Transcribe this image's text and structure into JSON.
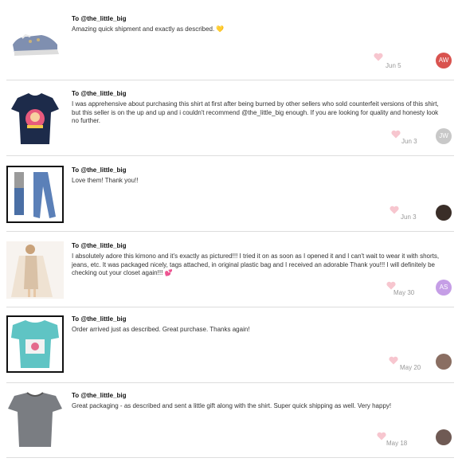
{
  "reviews": [
    {
      "to": "To @the_little_big",
      "message": "Amazing quick shipment and exactly as described. 💛",
      "date": "Jun 5",
      "avatar": {
        "initials": "AW",
        "color": "#d9534f"
      },
      "thumb": "sneaker-thumbnail"
    },
    {
      "to": "To @the_little_big",
      "message": "I was apprehensive about purchasing this shirt at first after being burned by other sellers who sold counterfeit versions of this shirt, but this seller is on the up and up and i couldn't recommend @the_little_big enough. If you are looking for quality and honesty look no further.",
      "date": "Jun 3",
      "avatar": {
        "initials": "JW",
        "color": "#c8c8c8"
      },
      "thumb": "tshirt-thumbnail"
    },
    {
      "to": "To @the_little_big",
      "message": "Love them! Thank you!!",
      "date": "Jun 3",
      "avatar": {
        "initials": "",
        "color": "#3a2e28"
      },
      "thumb": "jeans-thumbnail"
    },
    {
      "to": "To @the_little_big",
      "message": "I absolutely adore this kimono and it's exactly as pictured!!! I tried it on as soon as I opened it and I can't wait to wear it with shorts, jeans, etc. It was packaged nicely, tags attached, in original plastic bag and I received an adorable Thank you!!! I will definitely be checking out your closet again!!! 💕",
      "date": "May 30",
      "avatar": {
        "initials": "AS",
        "color": "#c59ee6"
      },
      "thumb": "kimono-thumbnail"
    },
    {
      "to": "To @the_little_big",
      "message": "Order arrived just as described. Great purchase. Thanks again!",
      "date": "May 20",
      "avatar": {
        "initials": "",
        "color": "#8a6e62"
      },
      "thumb": "teal-shirt-thumbnail"
    },
    {
      "to": "To @the_little_big",
      "message": "Great packaging - as described and sent a little gift along with the shirt. Super quick shipping as well. Very happy!",
      "date": "May 18",
      "avatar": {
        "initials": "",
        "color": "#6f5a54"
      },
      "thumb": "gray-shirt-thumbnail"
    }
  ]
}
